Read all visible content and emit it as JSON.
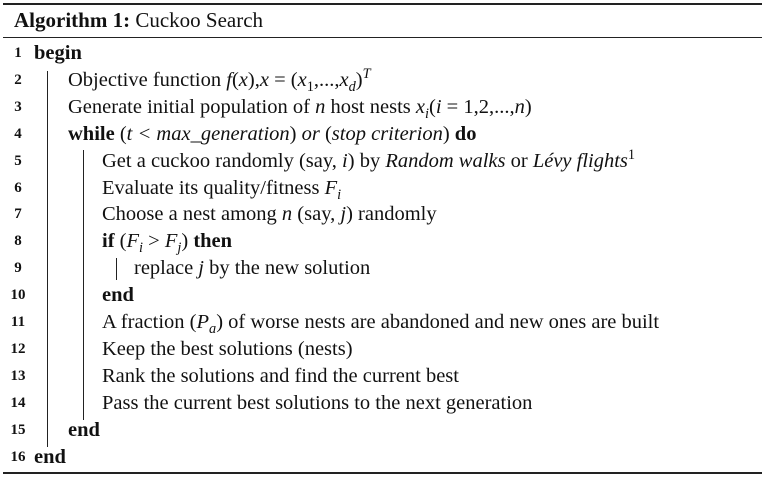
{
  "algorithm": {
    "label": "Algorithm 1:",
    "name": "Cuckoo Search"
  },
  "lines": [
    {
      "num": "1",
      "level": 0,
      "parts": [
        {
          "t": "begin",
          "s": "b"
        }
      ]
    },
    {
      "num": "2",
      "level": 1,
      "parts": [
        {
          "t": "Objective function "
        },
        {
          "t": "f",
          "s": "i"
        },
        {
          "t": "("
        },
        {
          "t": "x",
          "s": "i"
        },
        {
          "t": "),"
        },
        {
          "t": "x",
          "s": "i"
        },
        {
          "t": " = ("
        },
        {
          "t": "x",
          "s": "i"
        },
        {
          "t": "1",
          "s": "sub"
        },
        {
          "t": ",...,"
        },
        {
          "t": "x",
          "s": "i"
        },
        {
          "t": "d",
          "s": "sub-i"
        },
        {
          "t": ")"
        },
        {
          "t": "T",
          "s": "sup-i"
        }
      ]
    },
    {
      "num": "3",
      "level": 1,
      "parts": [
        {
          "t": "Generate initial population of "
        },
        {
          "t": "n",
          "s": "i"
        },
        {
          "t": " host nests "
        },
        {
          "t": "x",
          "s": "i"
        },
        {
          "t": "i",
          "s": "sub-i"
        },
        {
          "t": "("
        },
        {
          "t": "i",
          "s": "i"
        },
        {
          "t": " = 1,2,...,"
        },
        {
          "t": "n",
          "s": "i"
        },
        {
          "t": ")"
        }
      ]
    },
    {
      "num": "4",
      "level": 1,
      "parts": [
        {
          "t": "while",
          "s": "b"
        },
        {
          "t": " ("
        },
        {
          "t": "t < max_generation",
          "s": "i"
        },
        {
          "t": ") "
        },
        {
          "t": "or",
          "s": "i"
        },
        {
          "t": " ("
        },
        {
          "t": "stop criterion",
          "s": "i"
        },
        {
          "t": ") "
        },
        {
          "t": "do",
          "s": "b"
        }
      ]
    },
    {
      "num": "5",
      "level": 2,
      "parts": [
        {
          "t": "Get a cuckoo randomly (say, "
        },
        {
          "t": "i",
          "s": "i"
        },
        {
          "t": ") by "
        },
        {
          "t": "Random walks",
          "s": "i"
        },
        {
          "t": " or "
        },
        {
          "t": "Lévy flights",
          "s": "i"
        },
        {
          "t": "1",
          "s": "sup"
        }
      ]
    },
    {
      "num": "6",
      "level": 2,
      "parts": [
        {
          "t": "Evaluate its quality/fitness "
        },
        {
          "t": "F",
          "s": "i"
        },
        {
          "t": "i",
          "s": "sub-i"
        }
      ]
    },
    {
      "num": "7",
      "level": 2,
      "parts": [
        {
          "t": "Choose a nest among "
        },
        {
          "t": "n",
          "s": "i"
        },
        {
          "t": " (say, "
        },
        {
          "t": "j",
          "s": "i"
        },
        {
          "t": ") randomly"
        }
      ]
    },
    {
      "num": "8",
      "level": 2,
      "parts": [
        {
          "t": "if",
          "s": "b"
        },
        {
          "t": " ("
        },
        {
          "t": "F",
          "s": "i"
        },
        {
          "t": "i",
          "s": "sub-i"
        },
        {
          "t": " > "
        },
        {
          "t": "F",
          "s": "i"
        },
        {
          "t": "j",
          "s": "sub-i"
        },
        {
          "t": ") "
        },
        {
          "t": "then",
          "s": "b"
        }
      ]
    },
    {
      "num": "9",
      "level": 3,
      "parts": [
        {
          "t": "replace "
        },
        {
          "t": "j",
          "s": "i"
        },
        {
          "t": " by the new solution"
        }
      ]
    },
    {
      "num": "10",
      "level": 2,
      "parts": [
        {
          "t": "end",
          "s": "b"
        }
      ]
    },
    {
      "num": "11",
      "level": 2,
      "parts": [
        {
          "t": "A fraction ("
        },
        {
          "t": "P",
          "s": "i"
        },
        {
          "t": "a",
          "s": "sub-i"
        },
        {
          "t": ") of worse nests are abandoned and new ones are built"
        }
      ]
    },
    {
      "num": "12",
      "level": 2,
      "parts": [
        {
          "t": "Keep the best solutions (nests)"
        }
      ]
    },
    {
      "num": "13",
      "level": 2,
      "parts": [
        {
          "t": "Rank the solutions and find the current best"
        }
      ]
    },
    {
      "num": "14",
      "level": 2,
      "parts": [
        {
          "t": "Pass the current best solutions to the next generation"
        }
      ]
    },
    {
      "num": "15",
      "level": 1,
      "parts": [
        {
          "t": "end",
          "s": "b"
        }
      ]
    },
    {
      "num": "16",
      "level": 0,
      "parts": [
        {
          "t": "end",
          "s": "b"
        }
      ]
    }
  ]
}
